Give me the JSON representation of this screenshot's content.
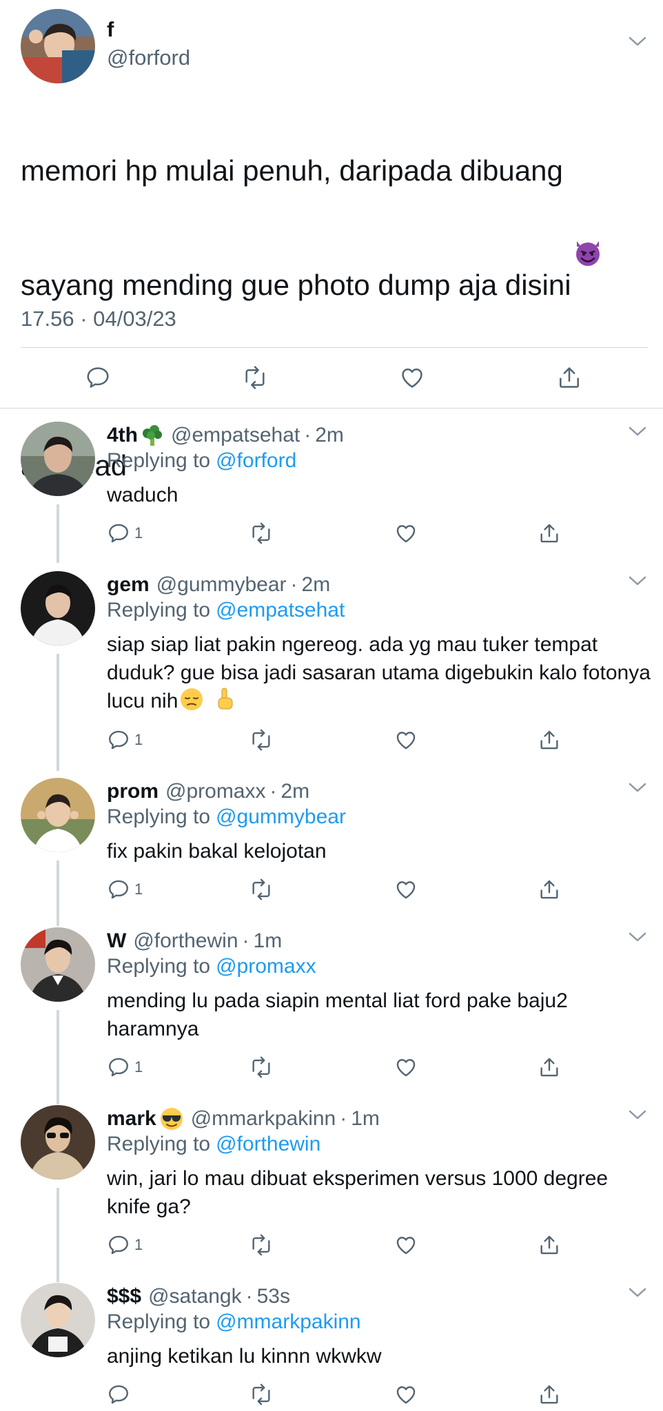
{
  "main_tweet": {
    "name": "f",
    "handle": "@forford",
    "text": "memori hp mulai penuh, daripada dibuang\nsayang mending gue photo dump aja disini",
    "text_emoji": "smiling-devil-emoji",
    "text_tail": "a thread",
    "timestamp": "17.56 · 04/03/23"
  },
  "replies": [
    {
      "name": "4th",
      "name_emoji": "broccoli-emoji",
      "handle": "@empatsehat",
      "time": "2m",
      "replying_label": "Replying to",
      "replying_to": "@forford",
      "text": "waduch",
      "reply_count": "1"
    },
    {
      "name": "gem",
      "handle": "@gummybear",
      "time": "2m",
      "replying_label": "Replying to",
      "replying_to": "@empatsehat",
      "text": "siap siap liat pakin ngereog. ada yg mau tuker tempat duduk? gue bisa jadi sasaran utama digebukin kalo fotonya lucu nih",
      "text_emojis": [
        "pensive-face-emoji",
        "index-pointing-up-emoji"
      ],
      "reply_count": "1"
    },
    {
      "name": "prom",
      "handle": "@promaxx",
      "time": "2m",
      "replying_label": "Replying to",
      "replying_to": "@gummybear",
      "text": "fix pakin bakal kelojotan",
      "reply_count": "1"
    },
    {
      "name": "W",
      "handle": "@forthewin",
      "time": "1m",
      "replying_label": "Replying to",
      "replying_to": "@promaxx",
      "text": "mending lu pada siapin mental liat ford pake baju2 haramnya",
      "reply_count": "1"
    },
    {
      "name": "mark",
      "name_emoji": "sunglasses-face-emoji",
      "handle": "@mmarkpakinn",
      "time": "1m",
      "replying_label": "Replying to",
      "replying_to": "@forthewin",
      "text": "win, jari lo mau dibuat eksperimen versus 1000 degree knife ga?",
      "reply_count": "1"
    },
    {
      "name": "$$$",
      "handle": "@satangk",
      "time": "53s",
      "replying_label": "Replying to",
      "replying_to": "@mmarkpakinn",
      "text": "anjing ketikan lu kinnn wkwkw",
      "reply_count": ""
    }
  ],
  "colors": {
    "text": "#0f1419",
    "secondary": "#536471",
    "link": "#1d9bf0",
    "divider": "#cfd9de"
  }
}
